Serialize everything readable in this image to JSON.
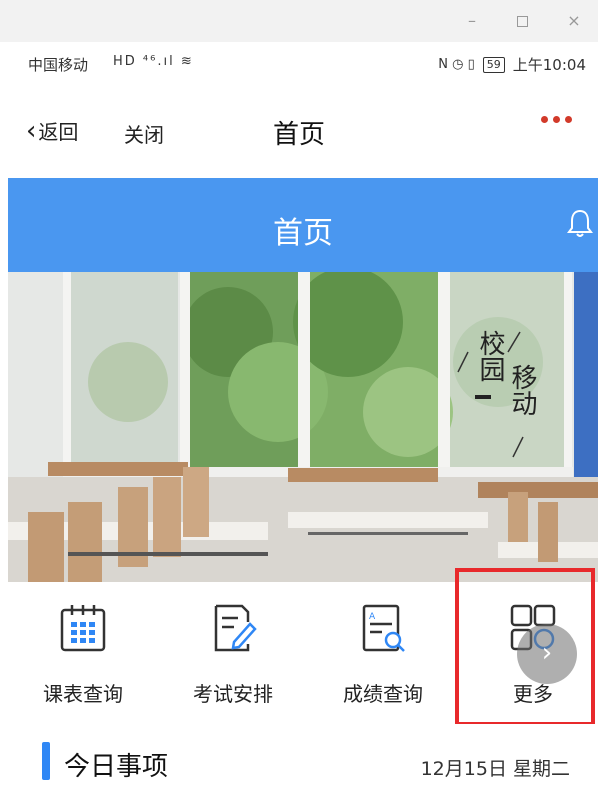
{
  "window": {
    "minimize": "–",
    "maximize": "",
    "close": "×"
  },
  "status_bar": {
    "carrier": "中国移动",
    "network_icons": "HD ⁴⁶.ıl ≋",
    "right_icons": "N ◷ ▯",
    "battery": "59",
    "time": "上午10:04"
  },
  "nav": {
    "back_label": "返回",
    "close_label": "关闭",
    "title": "首页"
  },
  "header": {
    "title": "首页",
    "bell_icon": "bell-icon"
  },
  "banner": {
    "line1": "校园",
    "line2": "移动"
  },
  "functions": [
    {
      "label": "课表查询",
      "icon": "calendar-icon"
    },
    {
      "label": "考试安排",
      "icon": "exam-edit-icon"
    },
    {
      "label": "成绩查询",
      "icon": "grade-search-icon"
    },
    {
      "label": "更多",
      "icon": "more-grid-icon"
    }
  ],
  "today": {
    "title": "今日事项",
    "date": "12月15日 星期二"
  },
  "colors": {
    "header_blue": "#4a97f0",
    "accent_blue": "#2f87f5",
    "highlight_red": "#e8292b",
    "dots_red": "#d23a2a"
  }
}
